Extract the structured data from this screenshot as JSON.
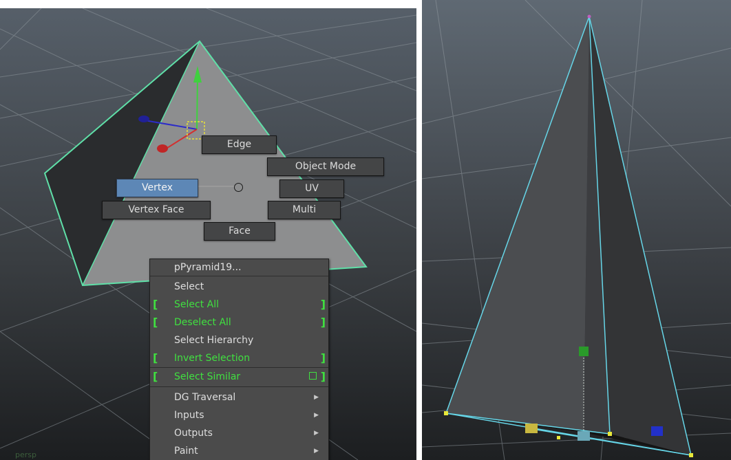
{
  "left_viewport": {
    "object_name": "pPyramid19...",
    "camera_label": "persp",
    "marking_menu": {
      "edge": "Edge",
      "object_mode": "Object Mode",
      "vertex": "Vertex",
      "uv": "UV",
      "vertex_face": "Vertex Face",
      "multi": "Multi",
      "face": "Face",
      "active_item": "Vertex"
    },
    "context_menu": {
      "title": "pPyramid19...",
      "items": [
        {
          "label": "Select",
          "highlighted": false,
          "brackets": false,
          "submenu": false
        },
        {
          "label": "Select All",
          "highlighted": true,
          "brackets": true,
          "submenu": false
        },
        {
          "label": "Deselect All",
          "highlighted": true,
          "brackets": true,
          "submenu": false
        },
        {
          "label": "Select Hierarchy",
          "highlighted": false,
          "brackets": false,
          "submenu": false
        },
        {
          "label": "Invert Selection",
          "highlighted": true,
          "brackets": true,
          "submenu": false
        },
        {
          "label": "Select Similar",
          "highlighted": true,
          "brackets": true,
          "submenu": false,
          "option_box": true
        },
        {
          "label": "DG Traversal",
          "highlighted": false,
          "brackets": false,
          "submenu": true
        },
        {
          "label": "Inputs",
          "highlighted": false,
          "brackets": false,
          "submenu": true
        },
        {
          "label": "Outputs",
          "highlighted": false,
          "brackets": false,
          "submenu": true
        },
        {
          "label": "Paint",
          "highlighted": false,
          "brackets": false,
          "submenu": true
        }
      ]
    }
  },
  "colors": {
    "viewport_top": "#565f69",
    "viewport_bottom": "#1c1e20",
    "selection_green": "#40e040",
    "active_blue": "#5d87b6",
    "wireframe_cyan": "#66d6e8",
    "selected_outline_green": "#5fe0a8"
  },
  "icons": [
    "move-manipulator-icon",
    "submenu-arrow-icon",
    "option-box-icon"
  ]
}
